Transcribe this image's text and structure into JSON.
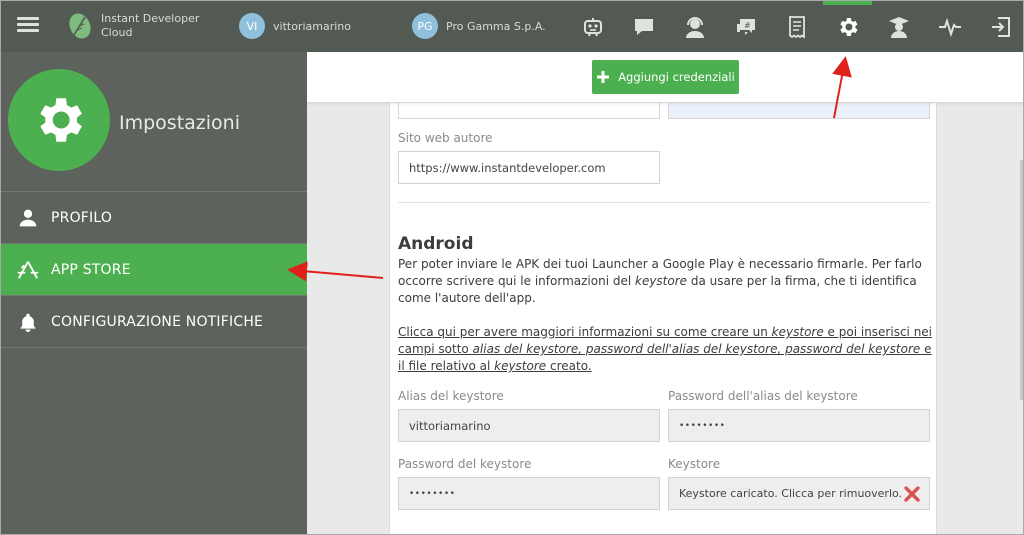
{
  "topbar": {
    "brand_line1": "Instant Developer",
    "brand_line2": "Cloud",
    "user_initials": "VI",
    "user_name": "vittoriamarino",
    "company_initials": "PG",
    "company_name": "Pro Gamma S.p.A.",
    "icons": [
      "robot-icon",
      "chat-icon",
      "support-icon",
      "forum-icon",
      "invoice-icon",
      "settings-icon",
      "academy-icon",
      "activity-icon",
      "logout-icon"
    ],
    "active_icon": "settings-icon"
  },
  "sidebar": {
    "title": "Impostazioni",
    "items": [
      {
        "label": "PROFILO",
        "icon": "user-icon"
      },
      {
        "label": "APP STORE",
        "icon": "app-store-icon"
      },
      {
        "label": "CONFIGURAZIONE NOTIFICHE",
        "icon": "bell-icon"
      }
    ],
    "active_item": "APP STORE"
  },
  "main": {
    "add_button_label": "Aggiungi credenziali",
    "website_label": "Sito web autore",
    "website_value": "https://www.instantdeveloper.com",
    "android_heading": "Android",
    "android_text_1": "Per poter inviare le APK dei tuoi Launcher a Google Play è necessario firmarle. Per farlo occorre scrivere qui le informazioni del ",
    "android_text_keystore": "keystore",
    "android_text_2": " da usare per la firma, che ti identifica come l'autore dell'app.",
    "link_text_1": "Clicca qui per avere maggiori informazioni su come creare un ",
    "link_text_keystore": "keystore",
    "link_text_2": " e poi inserisci nei campi sotto ",
    "link_text_fields": "alias del keystore, password dell'alias del keystore, password del keystore",
    "link_text_3": " e il file relativo al ",
    "link_text_keystore2": "keystore",
    "link_text_4": " creato.",
    "alias_label": "Alias del keystore",
    "alias_value": "vittoriamarino",
    "alias_password_label": "Password dell'alias del keystore",
    "alias_password_value": "••••••••",
    "keystore_password_label": "Password del keystore",
    "keystore_password_value": "••••••••",
    "keystore_label": "Keystore",
    "keystore_value": "Keystore caricato. Clicca per rimuoverlo."
  },
  "colors": {
    "topbar": "#535a53",
    "sidebar": "#5d625d",
    "accent_green": "#4caf50",
    "arrow_red": "#e0201b",
    "remove_red": "#d9534f"
  }
}
